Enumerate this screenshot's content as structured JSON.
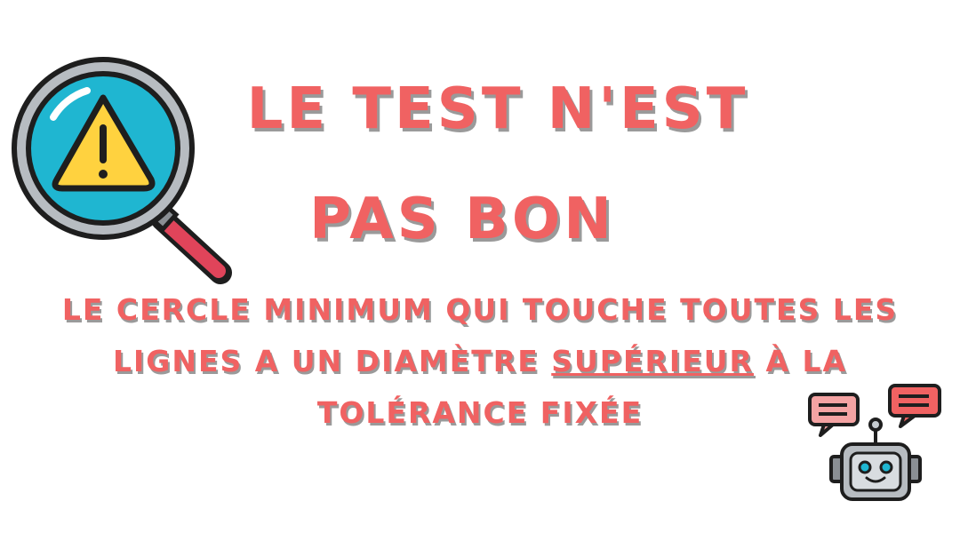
{
  "title": {
    "line1": "LE TEST N'EST",
    "line2": "PAS BON"
  },
  "message": {
    "line1": "LE CERCLE MINIMUM QUI TOUCHE TOUTES LES",
    "line2_before": "LIGNES A UN DIAMÈTRE ",
    "line2_emphasis": "SUPÉRIEUR",
    "line2_after": " À LA",
    "line3": "TOLÉRANCE FIXÉE"
  },
  "icons": {
    "warning": "magnifier-warning-icon",
    "robot": "robot-chat-icon"
  },
  "colors": {
    "text": "#f06262",
    "shadow": "#9a9a9a",
    "lens": "#1fb6d1",
    "warning": "#ffd23f",
    "handle": "#e0445a"
  }
}
